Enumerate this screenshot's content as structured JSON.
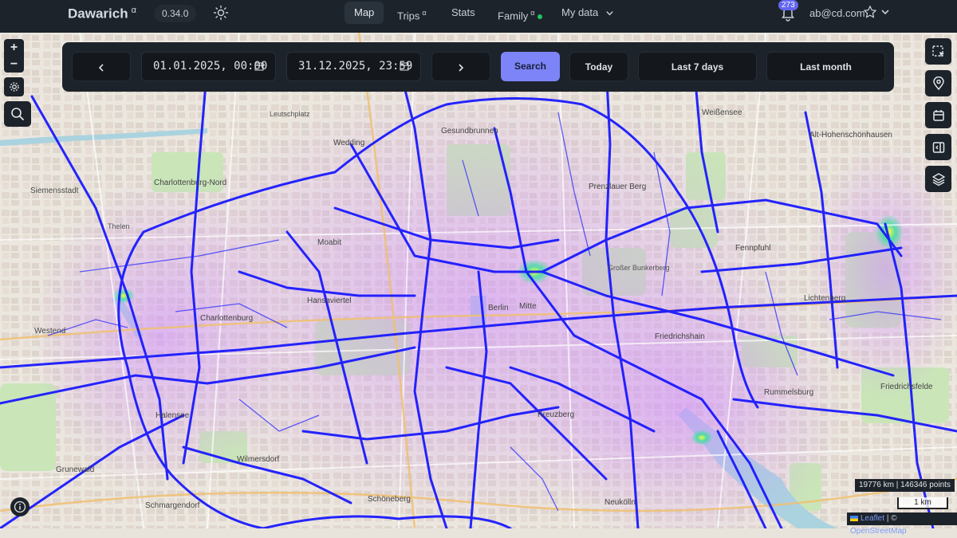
{
  "app": {
    "name": "Dawarich",
    "name_sup": "α",
    "version": "0.34.0"
  },
  "nav": {
    "map": "Map",
    "trips": "Trips",
    "trips_sup": "α",
    "stats": "Stats",
    "family": "Family",
    "family_sup": "α",
    "my_data": "My data"
  },
  "user": {
    "notifications": "273",
    "email": "ab@cd.com"
  },
  "date_panel": {
    "start": "01.01.2025, 00:00",
    "end": "31.12.2025, 23:59",
    "search": "Search",
    "today": "Today",
    "last7": "Last 7 days",
    "last_month": "Last month"
  },
  "map": {
    "labels": {
      "siemensstadt": "Siemensstadt",
      "charlottenburg_nord": "Charlottenburg-Nord",
      "wedding": "Wedding",
      "gesundbrunnen": "Gesundbrunnen",
      "moabit": "Moabit",
      "hansaviertel": "Hansaviertel",
      "charlottenburg": "Charlottenburg",
      "westend": "Westend",
      "mitte": "Mitte",
      "berlin": "Berlin",
      "prenzlauer_berg": "Prenzlauer Berg",
      "weissensee": "Weißensee",
      "alt_hohenschoenhausen": "Alt-Hohenschönhausen",
      "fennpfuhl": "Fennpfuhl",
      "lichtenberg": "Lichtenberg",
      "friedrichshain": "Friedrichshain",
      "rummelsburg": "Rummelsburg",
      "friedrichsfelde": "Friedrichsfelde",
      "kreuzberg": "Kreuzberg",
      "schoeneberg": "Schöneberg",
      "wilmersdorf": "Wilmersdorf",
      "halensee": "Halensee",
      "grunewald": "Grunewald",
      "schmargendorf": "Schmargendorf",
      "neukoelln": "Neukölln",
      "leutschplatz": "Leutschplatz",
      "grosser_bunkerberg": "Großer Bunkerberg",
      "thelen": "Thelen"
    },
    "stats": "19776 km | 146346 points",
    "scale": "1 km",
    "attribution_leaflet": "Leaflet",
    "attribution_sep": "| ©",
    "attribution_osm": "OpenStreetMap"
  },
  "controls": {
    "zoom_in": "+",
    "zoom_out": "−"
  },
  "colors": {
    "navbar": "#1d232a",
    "accent": "#7c84f7",
    "route": "#1414ff",
    "badge": "#6366f1"
  }
}
